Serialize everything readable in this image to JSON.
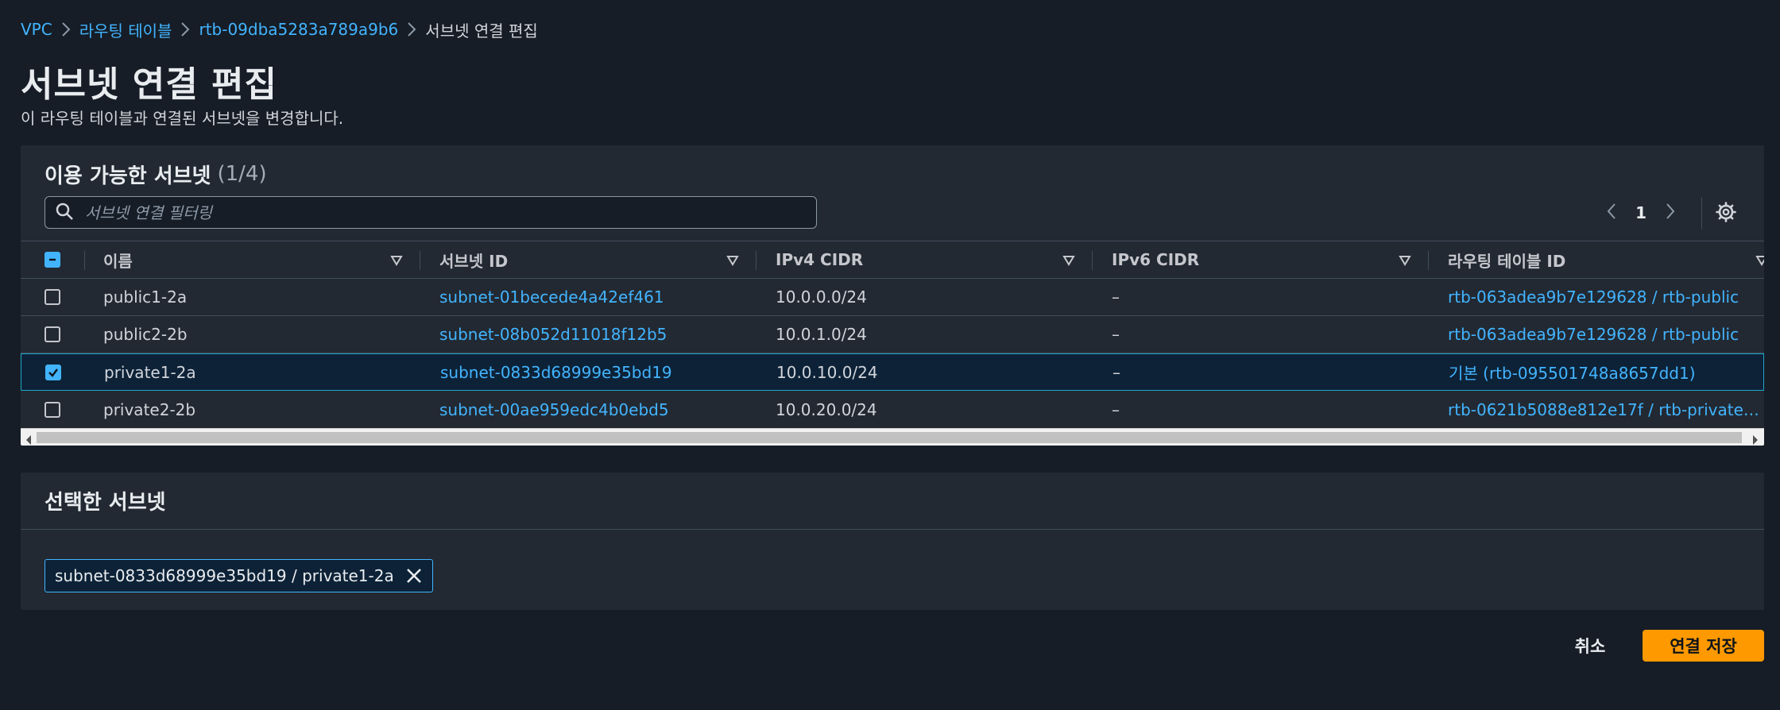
{
  "breadcrumb": {
    "items": [
      {
        "label": "VPC"
      },
      {
        "label": "라우팅 테이블"
      },
      {
        "label": "rtb-09dba5283a789a9b6"
      }
    ],
    "current": "서브넷 연결 편집"
  },
  "page": {
    "title": "서브넷 연결 편집",
    "description": "이 라우팅 테이블과 연결된 서브넷을 변경합니다."
  },
  "available": {
    "title": "이용 가능한 서브넷",
    "count": "(1/4)",
    "search_placeholder": "서브넷 연결 필터링",
    "page_number": "1",
    "columns": [
      "이름",
      "서브넷 ID",
      "IPv4 CIDR",
      "IPv6 CIDR",
      "라우팅 테이블 ID"
    ],
    "rows": [
      {
        "name": "public1-2a",
        "subnet_id": "subnet-01becede4a42ef461",
        "ipv4": "10.0.0.0/24",
        "ipv6": "–",
        "rtb": "rtb-063adea9b7e129628 / rtb-public",
        "checked": false
      },
      {
        "name": "public2-2b",
        "subnet_id": "subnet-08b052d11018f12b5",
        "ipv4": "10.0.1.0/24",
        "ipv6": "–",
        "rtb": "rtb-063adea9b7e129628 / rtb-public",
        "checked": false
      },
      {
        "name": "private1-2a",
        "subnet_id": "subnet-0833d68999e35bd19",
        "ipv4": "10.0.10.0/24",
        "ipv6": "–",
        "rtb": "기본 (rtb-095501748a8657dd1)",
        "checked": true
      },
      {
        "name": "private2-2b",
        "subnet_id": "subnet-00ae959edc4b0ebd5",
        "ipv4": "10.0.20.0/24",
        "ipv6": "–",
        "rtb": "rtb-0621b5088e812e17f / rtb-private…",
        "checked": false
      }
    ]
  },
  "selected": {
    "title": "선택한 서브넷",
    "token_label": "subnet-0833d68999e35bd19 / private1-2a"
  },
  "actions": {
    "cancel": "취소",
    "save": "연결 저장"
  },
  "colors": {
    "background": "#161d26",
    "panel": "#222932",
    "link": "#42b4ff",
    "primary": "#ff9900"
  }
}
